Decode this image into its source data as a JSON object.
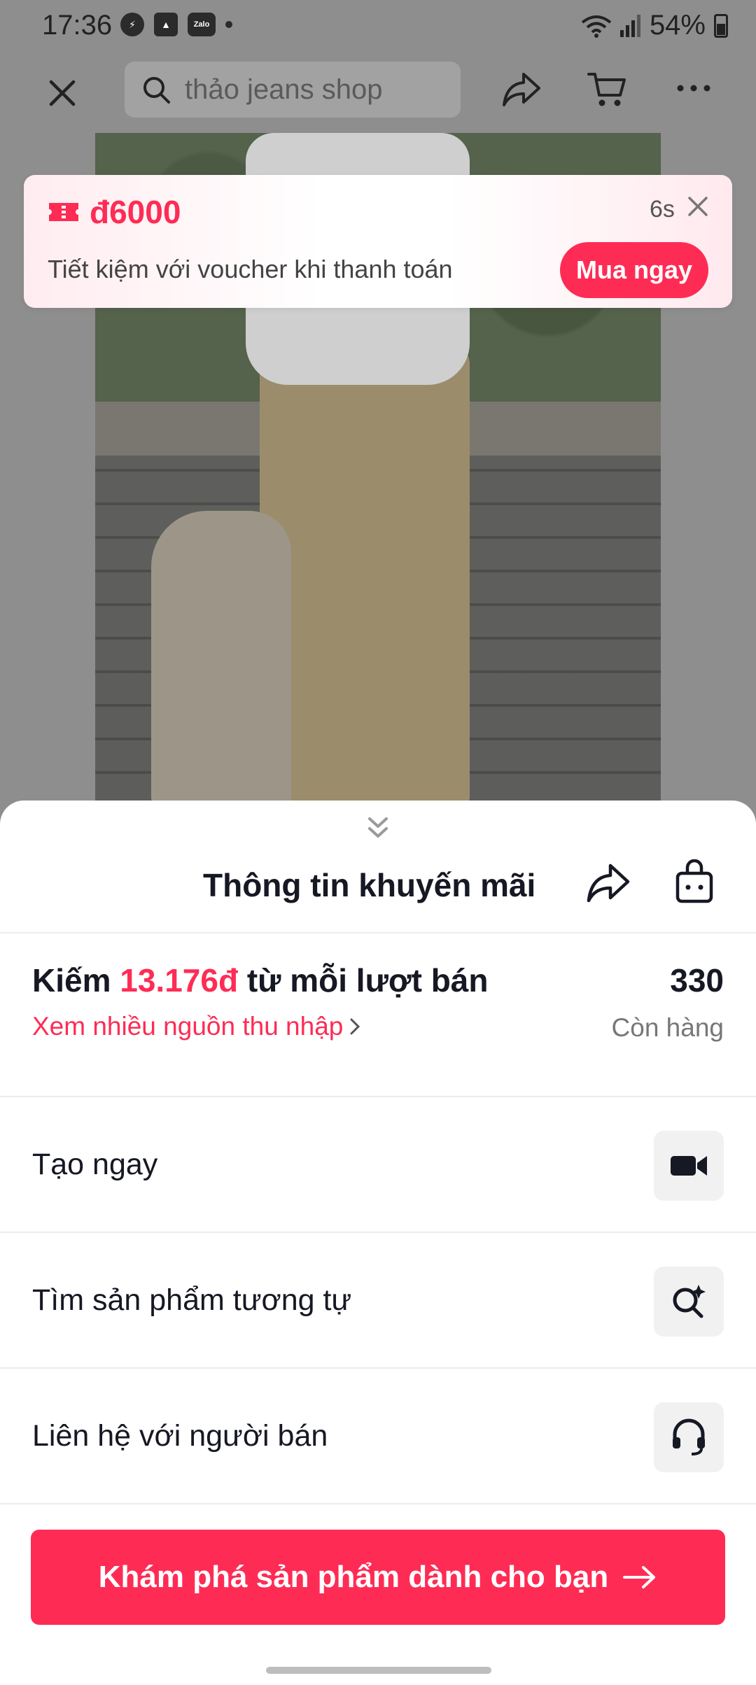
{
  "status_bar": {
    "time": "17:36",
    "left_icons": [
      "messenger-icon",
      "gallery-icon",
      "zalo-icon",
      "dot"
    ],
    "zalo_label": "Zalo",
    "battery": "54%"
  },
  "top_nav": {
    "search_placeholder": "thảo jeans shop"
  },
  "voucher": {
    "amount": "đ6000",
    "subtitle": "Tiết kiệm với voucher khi thanh toán",
    "timer": "6s",
    "button_label": "Mua ngay"
  },
  "sheet": {
    "title": "Thông tin khuyến mãi",
    "earn": {
      "prefix": "Kiếm ",
      "amount": "13.176đ",
      "suffix": " từ mỗi lượt bán",
      "link": "Xem nhiều nguồn thu nhập"
    },
    "stock": {
      "number": "330",
      "label": "Còn hàng"
    },
    "actions": [
      {
        "label": "Tạo ngay",
        "icon": "video-camera-icon"
      },
      {
        "label": "Tìm sản phẩm tương tự",
        "icon": "search-sparkle-icon"
      },
      {
        "label": "Liên hệ với người bán",
        "icon": "headset-icon"
      }
    ],
    "explore_button": "Khám phá sản phẩm dành cho bạn"
  },
  "colors": {
    "accent": "#fe2c55",
    "text_primary": "#161823",
    "text_secondary": "#777777",
    "dim_background": "#8e8e8e"
  }
}
